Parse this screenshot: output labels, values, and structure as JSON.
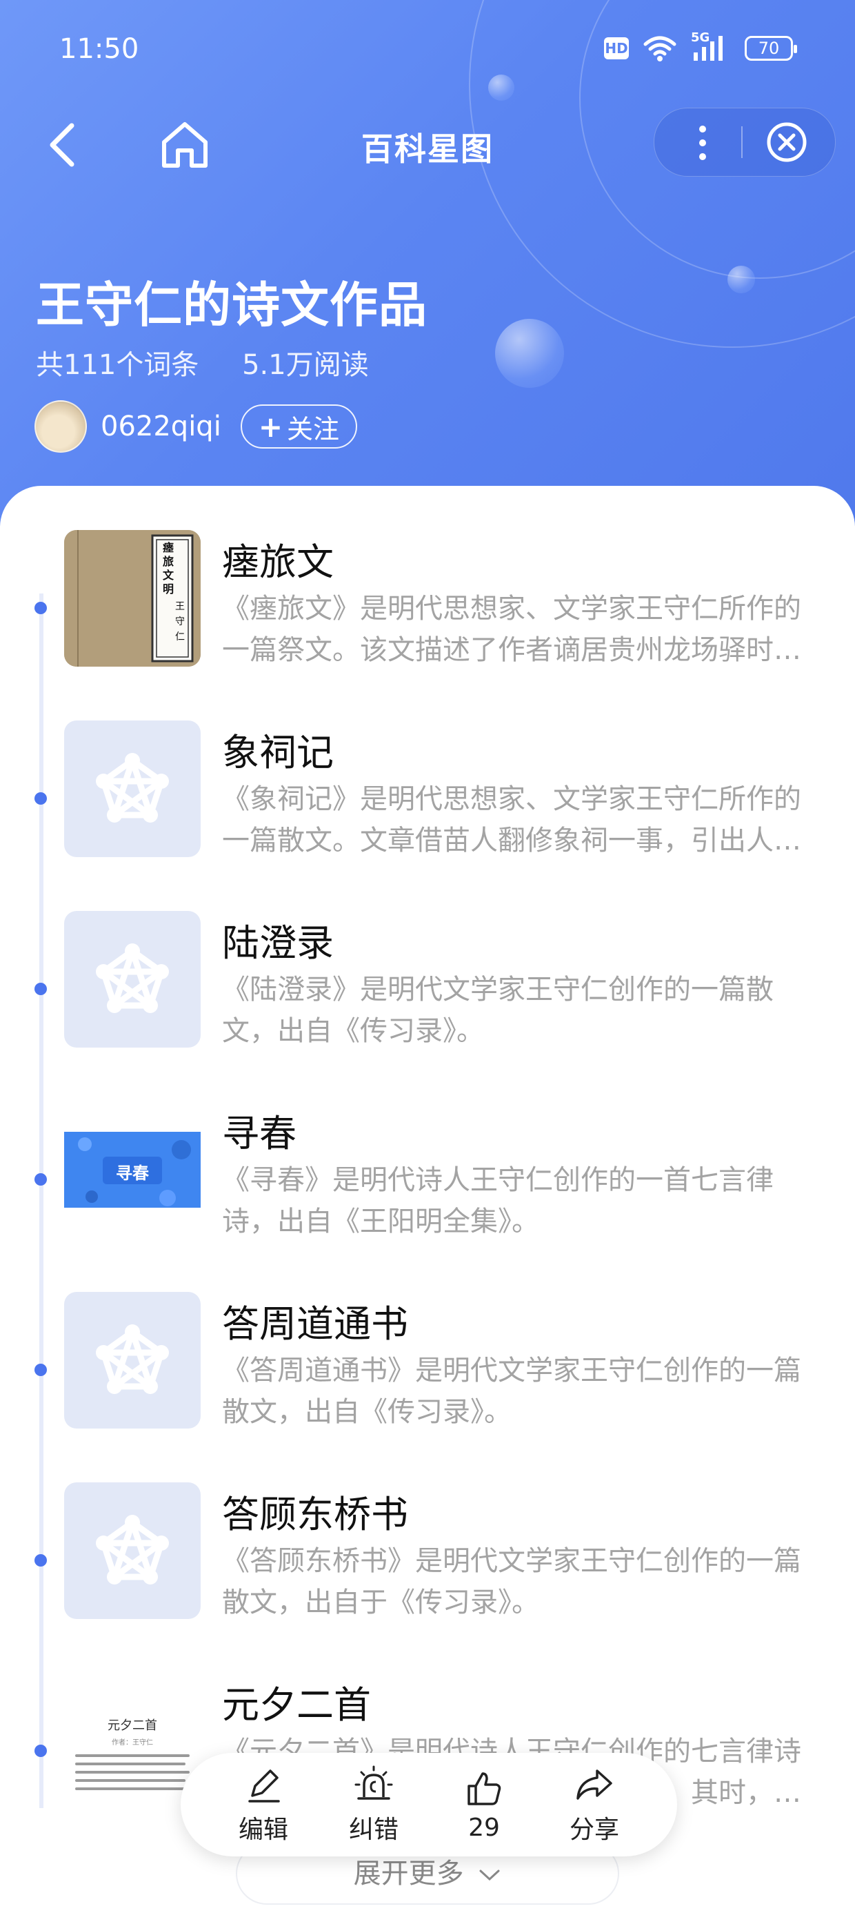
{
  "status_bar": {
    "time": "11:50",
    "hd": "HD",
    "network": "5G",
    "battery": "70"
  },
  "navbar": {
    "title": "百科星图"
  },
  "header": {
    "title": "王守仁的诗文作品",
    "entries": "共111个词条",
    "reads": "5.1万阅读",
    "author": "0622qiqi",
    "follow_label": "关注"
  },
  "thumb_texts": {
    "spring": "寻春",
    "poem_title": "元夕二首",
    "poem_author": "作者：王守仁",
    "scroll_chars": [
      "瘗",
      "旅",
      "文",
      "明",
      "王",
      "守",
      "仁"
    ]
  },
  "items": [
    {
      "title": "瘗旅文",
      "desc": "《瘗旅文》是明代思想家、文学家王守仁所作的一篇祭文。该文描述了作者谪居贵州龙场驿时目睹吏目一行三人客死异乡，作文以祭之。",
      "thumb": "scroll"
    },
    {
      "title": "象祠记",
      "desc": "《象祠记》是明代思想家、文学家王守仁所作的一篇散文。文章借苗人翻修象祠一事，引出人性可以改变的道理。",
      "thumb": "placeholder"
    },
    {
      "title": "陆澄录",
      "desc": "《陆澄录》是明代文学家王守仁创作的一篇散文，出自《传习录》。",
      "thumb": "placeholder"
    },
    {
      "title": "寻春",
      "desc": "《寻春》是明代诗人王守仁创作的一首七言律诗，出自《王阳明全集》。",
      "thumb": "spring"
    },
    {
      "title": "答周道通书",
      "desc": "《答周道通书》是明代文学家王守仁创作的一篇散文，出自《传习录》。",
      "thumb": "placeholder"
    },
    {
      "title": "答顾东桥书",
      "desc": "《答顾东桥书》是明代文学家王守仁创作的一篇散文，出自于《传习录》。",
      "thumb": "placeholder"
    },
    {
      "title": "元夕二首",
      "desc": "《元夕二首》是明代诗人王守仁创作的七言律诗组诗。此组诗作于正德三年元宵之夜，其时，作者正谪居贵州龙场。",
      "thumb": "poem"
    }
  ],
  "toolbar": {
    "edit": "编辑",
    "report": "纠错",
    "like_count": "29",
    "share": "分享"
  },
  "expand_label": "展开更多"
}
